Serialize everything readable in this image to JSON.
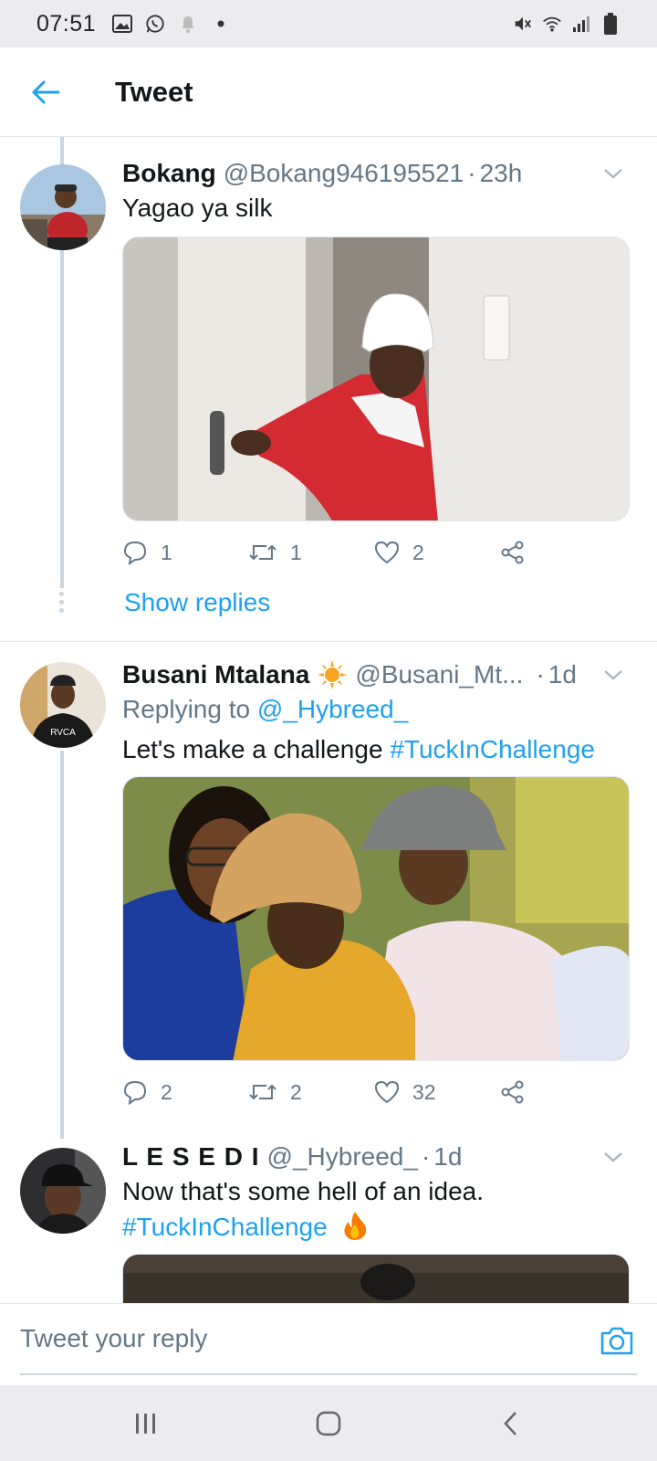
{
  "status_bar": {
    "time": "07:51",
    "left_icons": [
      "image-icon",
      "whatsapp-icon",
      "notification-icon",
      "dot-icon"
    ],
    "right_icons": [
      "mute-icon",
      "wifi-icon",
      "signal-icon",
      "battery-icon"
    ]
  },
  "header": {
    "back_icon": "arrow-left-icon",
    "title": "Tweet"
  },
  "tweets": [
    {
      "name": "Bokang",
      "handle": "@Bokang946195521",
      "separator": "·",
      "time": "23h",
      "text": "Yagao ya silk",
      "replies": "1",
      "retweets": "1",
      "likes": "2",
      "show_replies": "Show replies"
    },
    {
      "name": "Busani Mtalana",
      "badge_icon": "sun-emoji-icon",
      "handle": "@Busani_Mt...",
      "separator": "·",
      "time": "1d",
      "replying_prefix": "Replying to",
      "replying_to": "@_Hybreed_",
      "text": "Let's make a challenge",
      "hashtag": "#TuckInChallenge",
      "replies": "2",
      "retweets": "2",
      "likes": "32"
    },
    {
      "name": "L E S E D I",
      "handle": "@_Hybreed_",
      "separator": "·",
      "time": "1d",
      "text": "Now that's some hell of an idea.",
      "hashtag": "#TuckInChallenge",
      "emoji_icon": "fire-emoji-icon"
    }
  ],
  "reply_bar": {
    "placeholder": "Tweet your reply",
    "camera_icon": "camera-icon"
  },
  "nav_bar": {
    "icons": [
      "recent-apps-icon",
      "home-icon",
      "back-icon"
    ]
  },
  "colors": {
    "accent": "#1da1f2",
    "secondary_text": "#657786",
    "primary_text": "#14171a",
    "status_bar_bg": "#ececee"
  }
}
